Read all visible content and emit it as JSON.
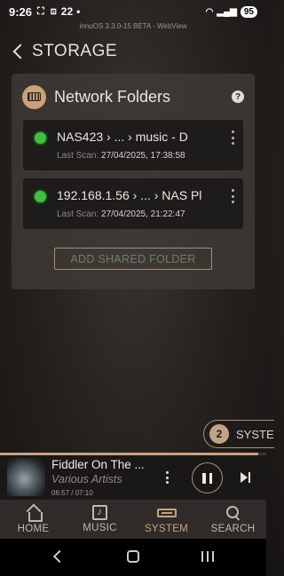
{
  "status_bar": {
    "time": "9:26",
    "notification_count": "22",
    "battery": "95"
  },
  "webview_label": "innuOS 3.3.0-15 BETA - WebView",
  "header": {
    "title": "STORAGE"
  },
  "network_folders": {
    "title": "Network Folders",
    "help_label": "?",
    "items": [
      {
        "path": "NAS423 › ... › music - D",
        "scan_label": "Last Scan:",
        "scan_value": "27/04/2025, 17:38:58",
        "status": "connected"
      },
      {
        "path": "192.168.1.56 › ... › NAS Pl",
        "scan_label": "Last Scan:",
        "scan_value": "27/04/2025, 21:22:47",
        "status": "connected"
      }
    ],
    "add_button_label": "ADD SHARED FOLDER"
  },
  "system_pill": {
    "count": "2",
    "label": "SYSTE"
  },
  "now_playing": {
    "title": "Fiddler On The ...",
    "artist": "Various Artists",
    "time": "06:57 / 07:10",
    "progress": 0.97
  },
  "bottom_nav": {
    "items": [
      {
        "label": "HOME",
        "icon": "home-icon",
        "active": false
      },
      {
        "label": "MUSIC",
        "icon": "music-icon",
        "active": false
      },
      {
        "label": "SYSTEM",
        "icon": "system-icon",
        "active": true
      },
      {
        "label": "SEARCH",
        "icon": "search-icon",
        "active": false
      }
    ]
  },
  "colors": {
    "accent": "#c9a27a",
    "status_ok": "#3ec13e",
    "panel_bg": "#3e3a36",
    "card_bg": "#1e1c1a"
  }
}
